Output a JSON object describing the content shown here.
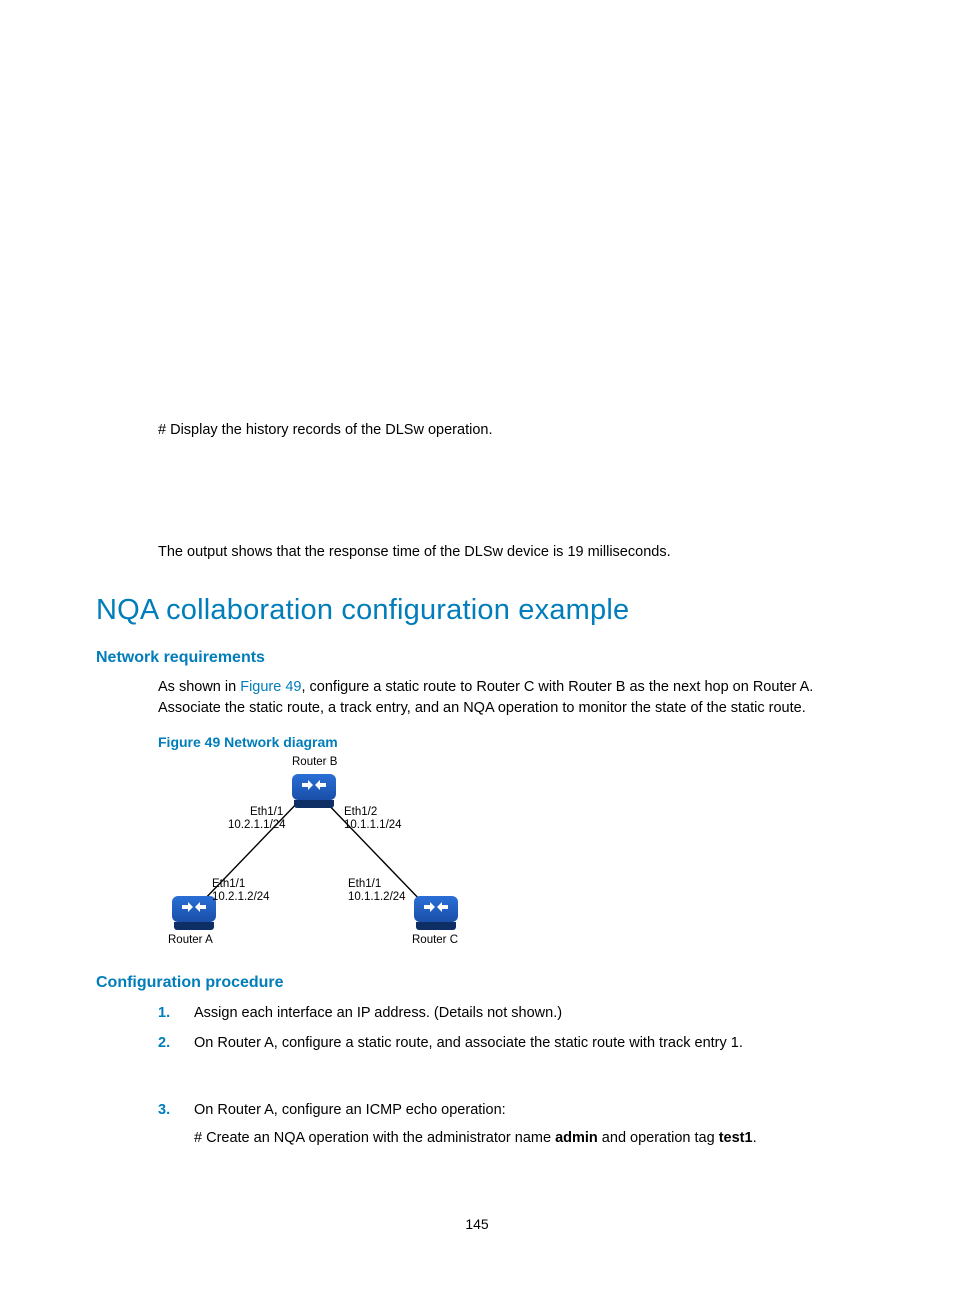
{
  "intro": {
    "line1": "# Display the history records of the DLSw operation.",
    "line2": "The output shows that the response time of the DLSw device is 19 milliseconds."
  },
  "h1": "NQA collaboration configuration example",
  "netreq": {
    "heading": "Network requirements",
    "text_a": "As shown in ",
    "figref": "Figure 49",
    "text_b": ", configure a static route to Router C with Router B as the next hop on Router A. Associate the static route, a track entry, and an NQA operation to monitor the state of the static route."
  },
  "figcap": "Figure 49 Network diagram",
  "diagram": {
    "routerB": "Router B",
    "routerA": "Router A",
    "routerC": "Router C",
    "b_eth11": "Eth1/1",
    "b_ip11": "10.2.1.1/24",
    "b_eth12": "Eth1/2",
    "b_ip12": "10.1.1.1/24",
    "a_eth": "Eth1/1",
    "a_ip": "10.2.1.2/24",
    "c_eth": "Eth1/1",
    "c_ip": "10.1.1.2/24"
  },
  "cfg": {
    "heading": "Configuration procedure",
    "step1": "Assign each interface an IP address. (Details not shown.)",
    "step2": "On Router A, configure a static route, and associate the static route with track entry 1.",
    "step3": "On Router A, configure an ICMP echo operation:",
    "step3a_a": "# Create an NQA operation with the administrator name ",
    "step3a_b": "admin",
    "step3a_c": " and operation tag ",
    "step3a_d": "test1",
    "step3a_e": "."
  },
  "pagenum": "145"
}
